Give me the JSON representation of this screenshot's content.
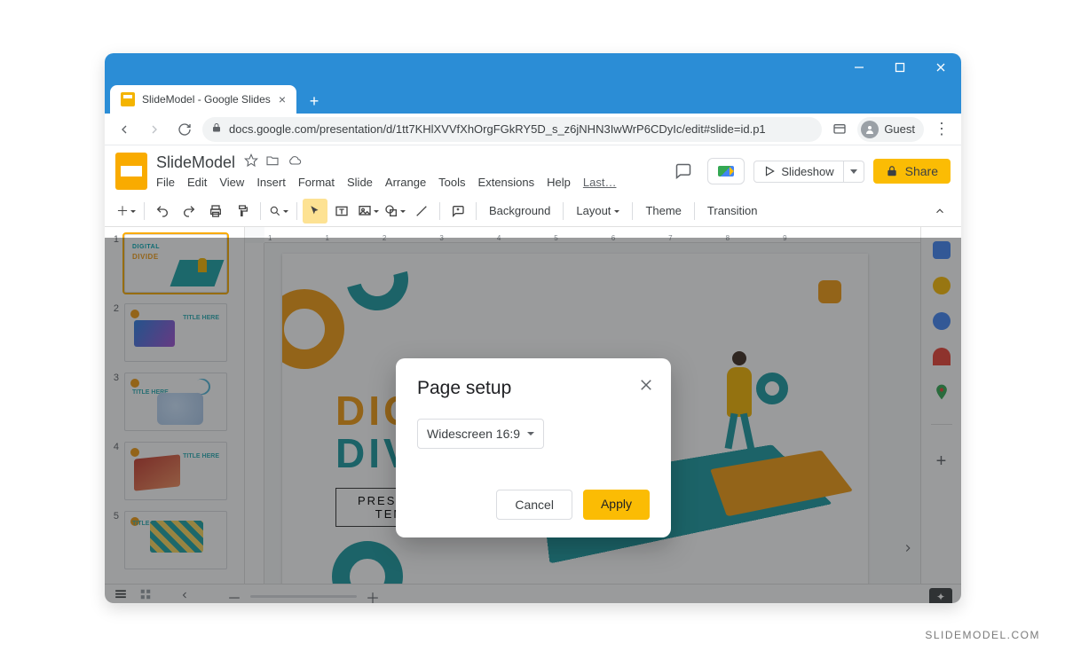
{
  "window": {
    "tab_title": "SlideModel - Google Slides",
    "url": "docs.google.com/presentation/d/1tt7KHlXVVfXhOrgFGkRY5D_s_z6jNHN3IwWrP6CDyIc/edit#slide=id.p1",
    "guest_label": "Guest"
  },
  "app": {
    "doc_title": "SlideModel",
    "menus": [
      "File",
      "Edit",
      "View",
      "Insert",
      "Format",
      "Slide",
      "Arrange",
      "Tools",
      "Extensions",
      "Help"
    ],
    "last_edit": "Last…",
    "slideshow_label": "Slideshow",
    "share_label": "Share"
  },
  "toolbar": {
    "background": "Background",
    "layout": "Layout",
    "theme": "Theme",
    "transition": "Transition"
  },
  "slide": {
    "hero_line1": "DIGITAL",
    "hero_line2": "DIVIDE",
    "sub_line1": "PRESENTATION",
    "sub_line2": "TEMPLATE"
  },
  "thumbs": {
    "t1": {
      "a": "DIGITAL",
      "b": "DIVIDE"
    },
    "title_here": "TITLE HERE"
  },
  "dialog": {
    "title": "Page setup",
    "selected": "Widescreen 16:9",
    "cancel": "Cancel",
    "apply": "Apply"
  },
  "ruler": [
    "1",
    "",
    "1",
    "2",
    "3",
    "4",
    "5",
    "6",
    "7",
    "8",
    "9"
  ],
  "watermark": "SLIDEMODEL.COM"
}
